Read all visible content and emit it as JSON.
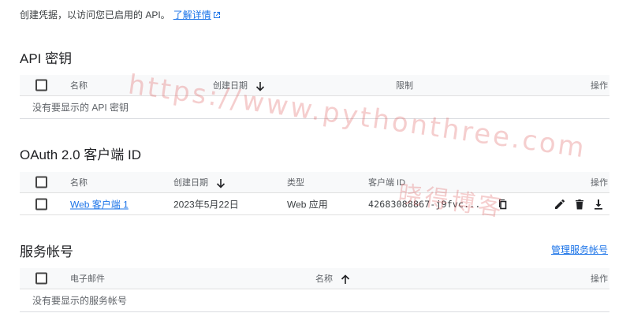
{
  "intro": {
    "text": "创建凭据，以访问您已启用的 API。",
    "learn_more": "了解详情"
  },
  "api_keys": {
    "title": "API 密钥",
    "columns": {
      "name": "名称",
      "created": "创建日期",
      "restrictions": "限制",
      "actions": "操作"
    },
    "empty_text": "没有要显示的 API 密钥"
  },
  "oauth": {
    "title": "OAuth 2.0 客户端 ID",
    "columns": {
      "name": "名称",
      "created": "创建日期",
      "type": "类型",
      "client_id": "客户端 ID",
      "actions": "操作"
    },
    "rows": [
      {
        "name": "Web 客户端 1",
        "created": "2023年5月22日",
        "type": "Web 应用",
        "client_id": "42683088867-j9fvc..."
      }
    ]
  },
  "service_accounts": {
    "title": "服务帐号",
    "manage_link": "管理服务帐号",
    "columns": {
      "email": "电子邮件",
      "name": "名称",
      "actions": "操作"
    },
    "empty_text": "没有要显示的服务帐号"
  },
  "watermark": {
    "url": "https://www.pythonthree.com",
    "text": "晓得博客"
  },
  "icons": {
    "external_link": "external-link-icon",
    "sort_down": "arrow-down-icon",
    "sort_up": "arrow-up-icon",
    "copy": "copy-icon",
    "edit": "pencil-icon",
    "delete": "trash-icon",
    "download": "download-icon"
  },
  "colors": {
    "link": "#1a73e8",
    "header_bg": "#f8f9fa",
    "watermark": "#dc5050"
  }
}
